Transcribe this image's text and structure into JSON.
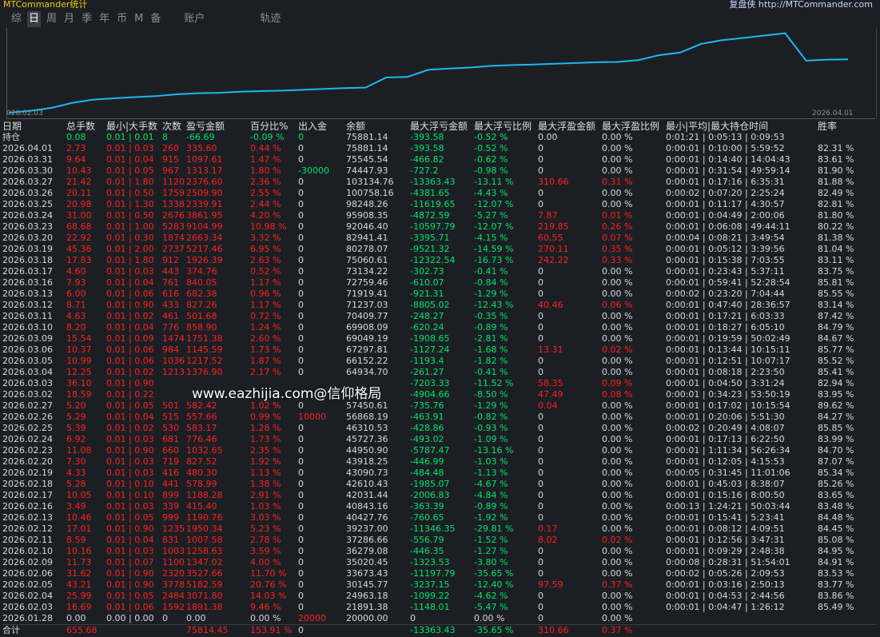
{
  "app_title": "MTCommander统计",
  "copyright": "复盘侠 http://MTCommander.com",
  "tabs": [
    "综",
    "日",
    "周",
    "月",
    "季",
    "年",
    "币",
    "M",
    "备",
    "账户",
    "轨迹"
  ],
  "active_tab": 1,
  "chart": {
    "start_date": "026.02.03",
    "end_date": "2026.04.01"
  },
  "equity_curve": [
    20000,
    21891,
    24963,
    30146,
    33673,
    35020,
    36279,
    37286,
    39237,
    40428,
    40843,
    42031,
    42610,
    43091,
    43918,
    44951,
    45727,
    46310,
    56868,
    57451,
    64935,
    66152,
    67298,
    69049,
    69908,
    70410,
    71237,
    71920,
    72759,
    73134,
    75061,
    80278,
    82941,
    92046,
    95908,
    98248,
    100758,
    103134,
    74448,
    75546,
    75881
  ],
  "columns": [
    "日期",
    "总手数",
    "最小|大手数",
    "次数",
    "盈亏金额",
    "百分比%",
    "出入金",
    "余额",
    "最大浮亏金额",
    "最大浮亏比例",
    "最大浮盈金额",
    "最大浮盈比例",
    "最小|平均|最大持仓时间",
    "胜率"
  ],
  "holding": [
    "持仓",
    "0.08",
    "0.01 | 0.01",
    "8",
    "-66.69",
    "-0.09 %",
    "0",
    "75881.14",
    "-393.58",
    "-0.52 %",
    "0.00",
    "0.00 %",
    "0:01:21 | 0:05:13 | 0:09:53",
    ""
  ],
  "rows": [
    [
      "2026.04.01",
      "2.73",
      "0.01 | 0.03",
      "260",
      "335.60",
      "0.44 %",
      "0",
      "75881.14",
      "-393.58",
      "-0.52 %",
      "0",
      "0.00 %",
      "0:00:01 | 0:10:00 | 5:59:52",
      "82.31 %"
    ],
    [
      "2026.03.31",
      "9.64",
      "0.01 | 0.04",
      "915",
      "1097.61",
      "1.47 %",
      "0",
      "75545.54",
      "-466.82",
      "-0.62 %",
      "0",
      "0.00 %",
      "0:00:01 | 0:14:40 | 14:04:43",
      "83.61 %"
    ],
    [
      "2026.03.30",
      "10.43",
      "0.01 | 0.05",
      "967",
      "1313.17",
      "1.80 %",
      "-30000",
      "74447.93",
      "-727.2",
      "-0.98 %",
      "0",
      "0.00 %",
      "0:00:01 | 0:31:54 | 49:59:14",
      "81.90 %"
    ],
    [
      "2026.03.27",
      "21.42",
      "0.01 | 1.80",
      "1120",
      "2376.60",
      "2.36 %",
      "0",
      "103134.76",
      "-13363.43",
      "-13.11 %",
      "310.66",
      "0.31 %",
      "0:00:01 | 0:17:16 | 6:35:31",
      "81.88 %"
    ],
    [
      "2026.03.26",
      "20.11",
      "0.01 | 0.50",
      "1759",
      "2509.90",
      "2.55 %",
      "0",
      "100758.16",
      "-4381.65",
      "-4.43 %",
      "0",
      "0.00 %",
      "0:00:02 | 0:07:20 | 2:25:24",
      "82.49 %"
    ],
    [
      "2026.03.25",
      "20.98",
      "0.01 | 1.30",
      "1338",
      "2339.91",
      "2.44 %",
      "0",
      "98248.26",
      "-11619.65",
      "-12.07 %",
      "0",
      "0.00 %",
      "0:00:01 | 0:11:17 | 4:30:57",
      "82.81 %"
    ],
    [
      "2026.03.24",
      "31.00",
      "0.01 | 0.50",
      "2676",
      "3861.95",
      "4.20 %",
      "0",
      "95908.35",
      "-4872.59",
      "-5.27 %",
      "7.87",
      "0.01 %",
      "0:00:01 | 0:04:49 | 2:00:06",
      "81.80 %"
    ],
    [
      "2026.03.23",
      "68.68",
      "0.01 | 1.00",
      "5283",
      "9104.99",
      "10.98 %",
      "0",
      "92046.40",
      "-10597.79",
      "-12.07 %",
      "219.85",
      "0.26 %",
      "0:00:01 | 0:06:08 | 49:44:11",
      "80.22 %"
    ],
    [
      "2026.03.20",
      "22.92",
      "0.01 | 0.30",
      "1874",
      "2663.34",
      "3.32 %",
      "0",
      "82941.41",
      "-3395.71",
      "-4.15 %",
      "60.55",
      "0.07 %",
      "0:00:04 | 0:08:21 | 3:49:54",
      "81.38 %"
    ],
    [
      "2026.03.19",
      "45.36",
      "0.01 | 2.00",
      "2737",
      "5217.46",
      "6.95 %",
      "0",
      "80278.07",
      "-9521.32",
      "-14.59 %",
      "270.11",
      "0.35 %",
      "0:00:01 | 0:05:12 | 3:39:56",
      "81.04 %"
    ],
    [
      "2026.03.18",
      "17.83",
      "0.01 | 1.80",
      "912",
      "1926.39",
      "2.63 %",
      "0",
      "75060.61",
      "-12322.54",
      "-16.73 %",
      "242.22",
      "0.33 %",
      "0:00:01 | 0:15:38 | 7:03:55",
      "83.11 %"
    ],
    [
      "2026.03.17",
      "4.60",
      "0.01 | 0.03",
      "443",
      "374.76",
      "0.52 %",
      "0",
      "73134.22",
      "-302.73",
      "-0.41 %",
      "0",
      "0.00 %",
      "0:00:01 | 0:23:43 | 5:37:11",
      "83.75 %"
    ],
    [
      "2026.03.16",
      "7.93",
      "0.01 | 0.04",
      "761",
      "840.05",
      "1.17 %",
      "0",
      "72759.46",
      "-610.07",
      "-0.84 %",
      "0",
      "0.00 %",
      "0:00:01 | 0:59:41 | 52:28:54",
      "85.81 %"
    ],
    [
      "2026.03.13",
      "6.00",
      "0.01 | 0.06",
      "616",
      "682.38",
      "0.96 %",
      "0",
      "71919.41",
      "-921.31",
      "-1.29 %",
      "0",
      "0.00 %",
      "0:00:02 | 0:23:20 | 7:04:44",
      "85.55 %"
    ],
    [
      "2026.03.12",
      "8.71",
      "0.01 | 0.90",
      "433",
      "827.26",
      "1.17 %",
      "0",
      "71237.03",
      "-8805.02",
      "-12.43 %",
      "40.46",
      "0.06 %",
      "0:00:01 | 0:47:40 | 28:36:57",
      "83.14 %"
    ],
    [
      "2026.03.11",
      "4.63",
      "0.01 | 0.02",
      "461",
      "501.68",
      "0.72 %",
      "0",
      "70409.77",
      "-248.27",
      "-0.35 %",
      "0",
      "0.00 %",
      "0:00:01 | 0:17:21 | 6:03:33",
      "87.42 %"
    ],
    [
      "2026.03.10",
      "8.20",
      "0.01 | 0.04",
      "776",
      "858.90",
      "1.24 %",
      "0",
      "69908.09",
      "-620.24",
      "-0.89 %",
      "0",
      "0.00 %",
      "0:00:01 | 0:18:27 | 6:05:10",
      "84.79 %"
    ],
    [
      "2026.03.09",
      "15.54",
      "0.01 | 0.09",
      "1474",
      "1751.38",
      "2.60 %",
      "0",
      "69049.19",
      "-1908.65",
      "-2.81 %",
      "0",
      "0.00 %",
      "0:00:01 | 0:19:59 | 50:02:49",
      "84.67 %"
    ],
    [
      "2026.03.06",
      "10.37",
      "0.01 | 0.06",
      "984",
      "1145.59",
      "1.73 %",
      "0",
      "67297.81",
      "-1127.24",
      "-1.68 %",
      "13.31",
      "0.02 %",
      "0:00:01 | 0:13:44 | 10:15:11",
      "85.77 %"
    ],
    [
      "2026.03.05",
      "10.99",
      "0.01 | 0.06",
      "1036",
      "1217.52",
      "1.87 %",
      "0",
      "66152.22",
      "-1193.4",
      "-1.82 %",
      "0",
      "0.00 %",
      "0:00:01 | 0:12:51 | 10:07:17",
      "85.52 %"
    ],
    [
      "2026.03.04",
      "12.25",
      "0.01 | 0.02",
      "1213",
      "1376.90",
      "2.17 %",
      "0",
      "64934.70",
      "-261.27",
      "-0.41 %",
      "0",
      "0.00 %",
      "0:00:01 | 0:08:18 | 2:23:50",
      "85.41 %"
    ],
    [
      "2026.03.03",
      "36.10",
      "0.01 | 0.90",
      "",
      "",
      "",
      "",
      "",
      "-7203.33",
      "-11.52 %",
      "58.35",
      "0.09 %",
      "0:00:01 | 0:04:50 | 3:31:24",
      "82.94 %"
    ],
    [
      "2026.03.02",
      "18.59",
      "0.01 | 0.22",
      "",
      "",
      "",
      "",
      "",
      "-4904.66",
      "-8.50 %",
      "47.49",
      "0.08 %",
      "0:00:01 | 0:34:23 | 53:50:19",
      "83.95 %"
    ],
    [
      "2026.02.27",
      "5.20",
      "0.01 | 0.05",
      "501",
      "582.42",
      "1.02 %",
      "0",
      "57450.61",
      "-735.76",
      "-1.29 %",
      "0.04",
      "0.00 %",
      "0:00:01 | 0:17:02 | 10:15:54",
      "89.62 %"
    ],
    [
      "2026.02.26",
      "5.29",
      "0.01 | 0.04",
      "515",
      "557.66",
      "0.99 %",
      "10000",
      "56868.19",
      "-463.91",
      "-0.82 %",
      "0",
      "0.00 %",
      "0:00:01 | 0:20:06 | 5:51:30",
      "84.27 %"
    ],
    [
      "2026.02.25",
      "5.39",
      "0.01 | 0.02",
      "530",
      "583.17",
      "1.28 %",
      "0",
      "46310.53",
      "-428.86",
      "-0.93 %",
      "0",
      "0.00 %",
      "0:00:02 | 0:20:49 | 4:08:07",
      "85.85 %"
    ],
    [
      "2026.02.24",
      "6.92",
      "0.01 | 0.03",
      "681",
      "776.46",
      "1.73 %",
      "0",
      "45727.36",
      "-493.02",
      "-1.09 %",
      "0",
      "0.00 %",
      "0:00:01 | 0:17:13 | 6:22:50",
      "83.99 %"
    ],
    [
      "2026.02.23",
      "11.08",
      "0.01 | 0.90",
      "660",
      "1032.65",
      "2.35 %",
      "0",
      "44950.90",
      "-5787.47",
      "-13.16 %",
      "0",
      "0.00 %",
      "0:00:01 | 1:11:34 | 56:26:34",
      "84.70 %"
    ],
    [
      "2026.02.20",
      "7.30",
      "0.01 | 0.03",
      "719",
      "827.52",
      "1.92 %",
      "0",
      "43918.25",
      "-446.99",
      "-1.03 %",
      "0",
      "0.00 %",
      "0:00:01 | 0:12:05 | 4:15:53",
      "87.07 %"
    ],
    [
      "2026.02.19",
      "4.33",
      "0.01 | 0.03",
      "416",
      "480.30",
      "1.13 %",
      "0",
      "43090.73",
      "-484.48",
      "-1.13 %",
      "0",
      "0.00 %",
      "0:00:05 | 0:31:45 | 11:01:06",
      "85.34 %"
    ],
    [
      "2026.02.18",
      "5.28",
      "0.01 | 0.10",
      "441",
      "578.99",
      "1.38 %",
      "0",
      "42610.43",
      "-1985.07",
      "-4.67 %",
      "0",
      "0.00 %",
      "0:00:01 | 0:45:03 | 8:38:07",
      "85.26 %"
    ],
    [
      "2026.02.17",
      "10.05",
      "0.01 | 0.10",
      "899",
      "1188.28",
      "2.91 %",
      "0",
      "42031.44",
      "-2006.83",
      "-4.84 %",
      "0",
      "0.00 %",
      "0:00:01 | 0:15:16 | 8:00:50",
      "83.65 %"
    ],
    [
      "2026.02.16",
      "3.49",
      "0.01 | 0.03",
      "339",
      "415.40",
      "1.03 %",
      "0",
      "40843.16",
      "-363.39",
      "-0.89 %",
      "0",
      "0.00 %",
      "0:00:13 | 1:24:21 | 50:03:44",
      "83.48 %"
    ],
    [
      "2026.02.13",
      "10.46",
      "0.01 | 0.05",
      "999",
      "1190.76",
      "3.03 %",
      "0",
      "40427.76",
      "-760.65",
      "-1.92 %",
      "0",
      "0.00 %",
      "0:00:01 | 0:15:41 | 5:23:41",
      "84.48 %"
    ],
    [
      "2026.02.12",
      "17.01",
      "0.01 | 0.90",
      "1235",
      "1950.34",
      "5.23 %",
      "0",
      "39237.00",
      "-11346.35",
      "-29.81 %",
      "0.17",
      "0.00 %",
      "0:00:01 | 0:08:12 | 4:09:51",
      "84.45 %"
    ],
    [
      "2026.02.11",
      "8.59",
      "0.01 | 0.04",
      "831",
      "1007.58",
      "2.78 %",
      "0",
      "37286.66",
      "-556.79",
      "-1.52 %",
      "8.02",
      "0.02 %",
      "0:00:01 | 0:12:56 | 3:47:31",
      "85.08 %"
    ],
    [
      "2026.02.10",
      "10.16",
      "0.01 | 0.03",
      "1003",
      "1258.63",
      "3.59 %",
      "0",
      "36279.08",
      "-446.35",
      "-1.27 %",
      "0",
      "0.00 %",
      "0:00:01 | 0:09:29 | 2:48:38",
      "84.95 %"
    ],
    [
      "2026.02.09",
      "11.73",
      "0.01 | 0.07",
      "1100",
      "1347.02",
      "4.00 %",
      "0",
      "35020.45",
      "-1323.53",
      "-3.80 %",
      "0",
      "0.00 %",
      "0:00:08 | 0:28:31 | 51:54:01",
      "84.91 %"
    ],
    [
      "2026.02.06",
      "31.62",
      "0.01 | 0.90",
      "2320",
      "3527.66",
      "11.70 %",
      "0",
      "33673.43",
      "-11197.79",
      "-35.65 %",
      "0",
      "0.00 %",
      "0:00:02 | 0:05:26 | 2:09:53",
      "83.53 %"
    ],
    [
      "2026.02.05",
      "43.21",
      "0.01 | 0.90",
      "3778",
      "5182.59",
      "20.76 %",
      "0",
      "30145.77",
      "-3237.15",
      "-12.40 %",
      "97.59",
      "0.37 %",
      "0:00:01 | 0:03:16 | 2:50:13",
      "83.77 %"
    ],
    [
      "2026.02.04",
      "25.99",
      "0.01 | 0.05",
      "2484",
      "3071.80",
      "14.03 %",
      "0",
      "24963.18",
      "-1099.22",
      "-4.62 %",
      "0",
      "0.00 %",
      "0:00:01 | 0:04:53 | 2:44:56",
      "83.86 %"
    ],
    [
      "2026.02.03",
      "16.69",
      "0.01 | 0.06",
      "1592",
      "1891.38",
      "9.46 %",
      "0",
      "21891.38",
      "-1148.01",
      "-5.47 %",
      "0",
      "0.00 %",
      "0:00:01 | 0:04:47 | 1:26:12",
      "85.49 %"
    ],
    [
      "2026.01.28",
      "0.00",
      "0.00 | 0.00",
      "0",
      "0.00",
      "0.00 %",
      "20000",
      "20000.00",
      "0",
      "0.00 %",
      "0",
      "0.00 %",
      "",
      ""
    ]
  ],
  "total": [
    "合计",
    "655.68",
    "",
    "",
    "75814.45",
    "153.91 %",
    "0",
    "",
    "-13363.43",
    "-35.65 %",
    "310.66",
    "0.37 %",
    "",
    ""
  ],
  "watermark": "www.eazhijia.com@信仰格局"
}
